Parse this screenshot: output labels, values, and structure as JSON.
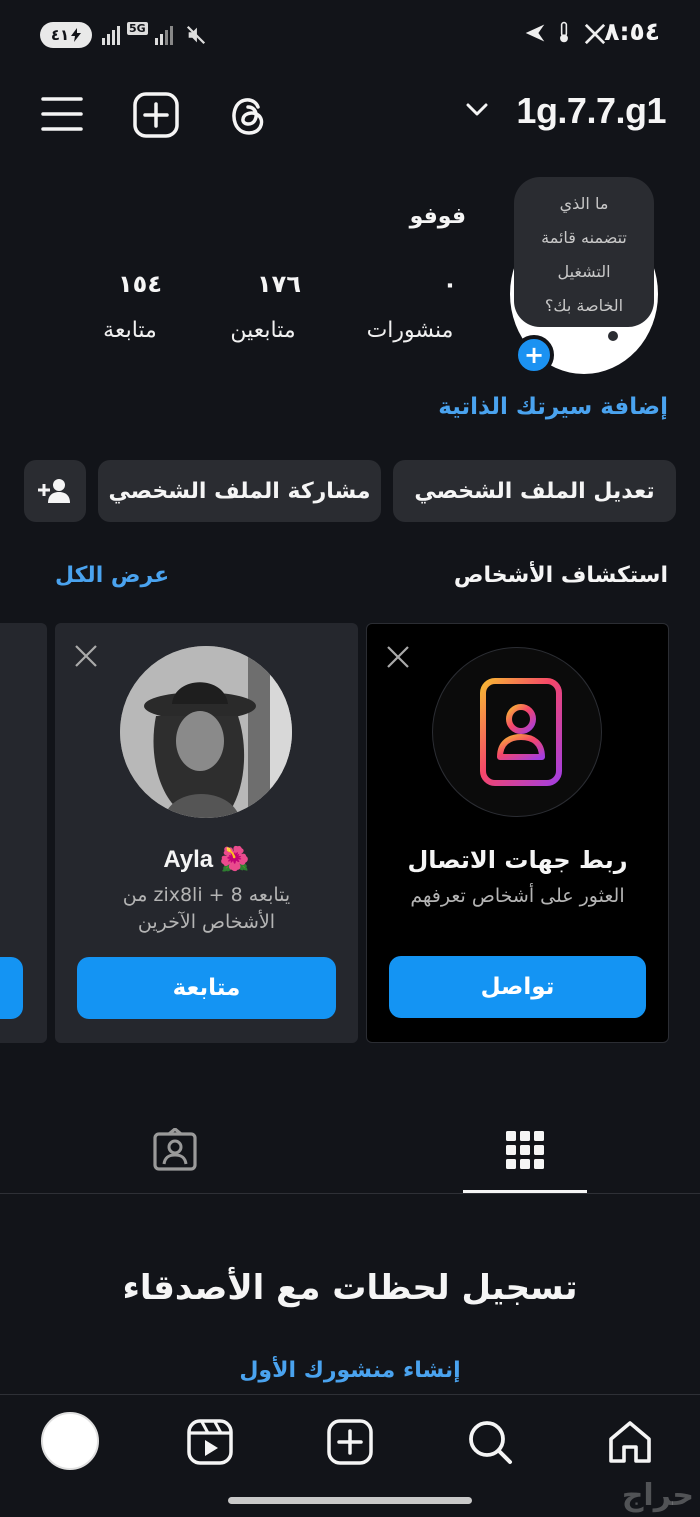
{
  "status_bar": {
    "time": "٨:٥٤",
    "battery": "٤١",
    "network": "5G"
  },
  "header": {
    "username": "1g.7.7.g1",
    "icons": [
      "menu-icon",
      "create-icon",
      "threads-icon",
      "chevron-down-icon"
    ]
  },
  "profile": {
    "display_name": "فوفو",
    "note_bubble": [
      "ما الذي",
      "تتضمنه قائمة",
      "التشغيل",
      "الخاصة بك؟"
    ],
    "add_story_symbol": "+",
    "stats": [
      {
        "value": "٠",
        "label": "منشورات"
      },
      {
        "value": "١٧٦",
        "label": "متابعين"
      },
      {
        "value": "١٥٤",
        "label": "متابعة"
      }
    ],
    "bio_link": "إضافة سيرتك الذاتية"
  },
  "actions": {
    "edit_profile": "تعديل الملف الشخصي",
    "share_profile": "مشاركة الملف الشخصي"
  },
  "discover": {
    "title": "استكشاف الأشخاص",
    "see_all": "عرض الكل",
    "cards": [
      {
        "title": "ربط جهات الاتصال",
        "subtitle": "العثور على أشخاص تعرفهم",
        "button": "تواصل"
      },
      {
        "title": "🌺 Ayla",
        "subtitle_line1": "يتابعه zix8li + 8 من",
        "subtitle_line2": "الأشخاص الآخرين",
        "button": "متابعة"
      }
    ]
  },
  "empty_state": {
    "title": "تسجيل لحظات مع الأصدقاء",
    "link": "إنشاء منشورك الأول"
  },
  "watermark": "حراج",
  "colors": {
    "background": "#121419",
    "accent": "#1494f3",
    "link": "#4aa3ef",
    "button_grey": "#2a2c31"
  }
}
